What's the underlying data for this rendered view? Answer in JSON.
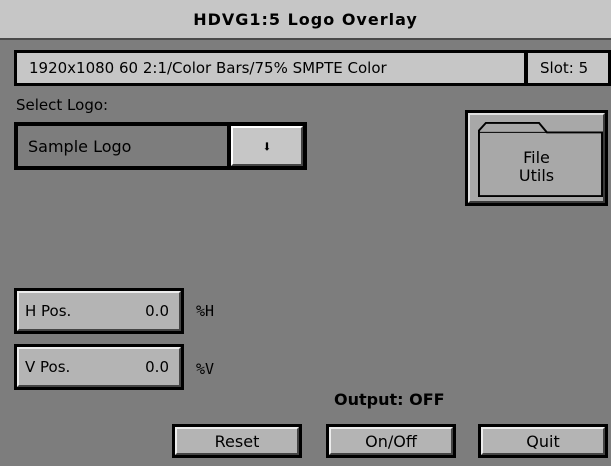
{
  "window": {
    "title": "HDVG1:5  Logo Overlay"
  },
  "status": {
    "format": "1920x1080  60 2:1/Color Bars/75% SMPTE  Color",
    "slot": "Slot: 5"
  },
  "logo": {
    "label": "Select Logo:",
    "value": "Sample Logo",
    "dropdown_glyph": "⬇"
  },
  "file_utils": {
    "line1": "File",
    "line2": "Utils"
  },
  "h_pos": {
    "label": "H Pos.",
    "value": "0.0",
    "unit": "%H"
  },
  "v_pos": {
    "label": "V Pos.",
    "value": "0.0",
    "unit": "%V"
  },
  "output": {
    "text": "Output: OFF"
  },
  "buttons": {
    "reset": "Reset",
    "onoff": "On/Off",
    "quit": "Quit"
  },
  "colors": {
    "background": "#7d7d7d",
    "panel": "#c6c6c6",
    "button": "#b4b4b4",
    "border": "#000000"
  }
}
